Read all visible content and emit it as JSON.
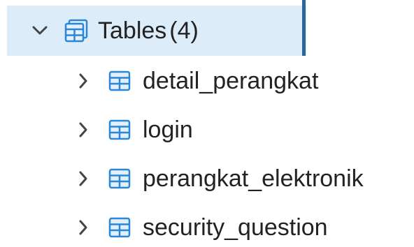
{
  "tree": {
    "group": {
      "label": "Tables",
      "count": "(4)",
      "expanded": true,
      "icon": "tables-group-icon",
      "caret_icon": "chevron-down-icon"
    },
    "tables": [
      {
        "label": "detail_perangkat",
        "icon": "table-icon",
        "caret_icon": "chevron-right-icon"
      },
      {
        "label": "login",
        "icon": "table-icon",
        "caret_icon": "chevron-right-icon"
      },
      {
        "label": "perangkat_elektronik",
        "icon": "table-icon",
        "caret_icon": "chevron-right-icon"
      },
      {
        "label": "security_question",
        "icon": "table-icon",
        "caret_icon": "chevron-right-icon"
      }
    ]
  },
  "colors": {
    "selected_background": "#dcecf9",
    "selected_accent": "#2c6699",
    "icon_blue": "#2b86d6",
    "icon_fill": "#e3f0fb",
    "text": "#222222"
  }
}
